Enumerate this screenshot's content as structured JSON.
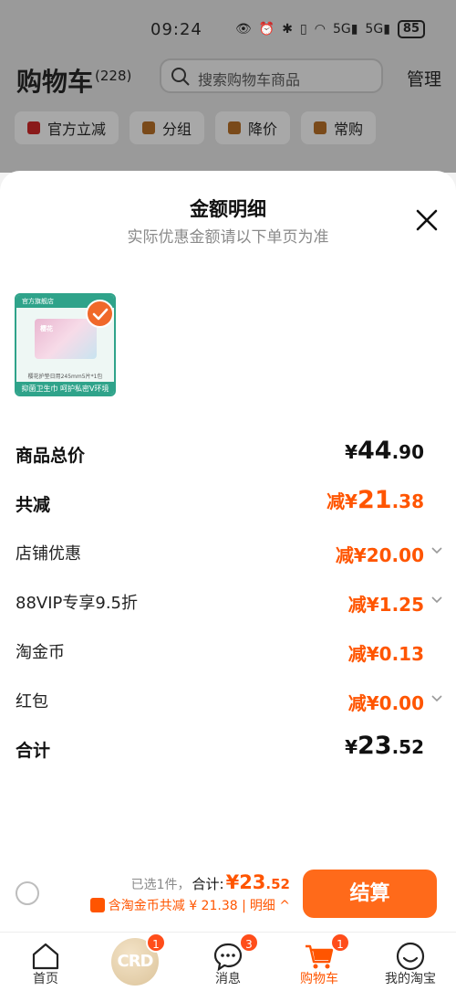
{
  "status_bar": {
    "time": "09:24",
    "signal_1": "5G",
    "signal_2": "5G",
    "battery": "85"
  },
  "cart_header": {
    "title": "购物车",
    "count": "(228)",
    "search_placeholder": "搜索购物车商品",
    "manage": "管理",
    "chips": [
      "官方立减",
      "分组",
      "降价",
      "常购"
    ]
  },
  "sheet": {
    "title": "金额明细",
    "subtitle": "实际优惠金额请以下单页为准"
  },
  "product": {
    "top_text": "官方旗舰店",
    "box_label": "樱花",
    "spec": "樱花护垫日用245mm5片*1包",
    "banner": "抑菌卫生巾 呵护私密V环境"
  },
  "breakdown": {
    "goods_total": {
      "label": "商品总价",
      "currency": "¥",
      "int": "44",
      "dec": ".90"
    },
    "total_discount": {
      "label": "共减",
      "prefix": "减¥",
      "int": "21",
      "dec": ".38"
    },
    "shop_coupon": {
      "label": "店铺优惠",
      "value": "减¥20.00"
    },
    "vip": {
      "label": "88VIP专享9.5折",
      "value": "减¥1.25"
    },
    "coins": {
      "label": "淘金币",
      "value": "减¥0.13"
    },
    "red_packet": {
      "label": "红包",
      "value": "减¥0.00"
    },
    "sum": {
      "label": "合计",
      "currency": "¥",
      "int": "23",
      "dec": ".52"
    }
  },
  "checkout": {
    "selected": "已选1件，",
    "total_label": "合计:",
    "total_int": "¥23",
    "total_dec": ".52",
    "coin_note": "含淘金币共减 ¥ 21.38 |",
    "detail": "明细 ^",
    "pay_button": "结算"
  },
  "tabbar": {
    "tabs": [
      {
        "label": "首页"
      },
      {
        "label": "CRD",
        "badge": "1"
      },
      {
        "label": "消息",
        "badge": "3"
      },
      {
        "label": "购物车",
        "badge": "1"
      },
      {
        "label": "我的淘宝"
      }
    ]
  },
  "colors": {
    "accent": "#ff5500",
    "button": "#ff6a1a",
    "brand_green": "#2fa38a"
  }
}
